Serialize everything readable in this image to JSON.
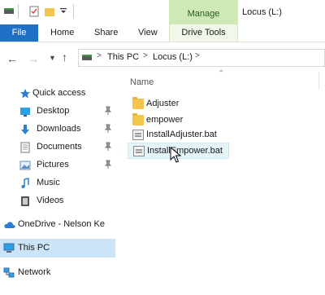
{
  "ribbon": {
    "manage_label": "Manage",
    "window_title": "Locus (L:)",
    "tabs": [
      "File",
      "Home",
      "Share",
      "View",
      "Drive Tools"
    ]
  },
  "address": {
    "crumbs": [
      "This PC",
      "Locus (L:)"
    ]
  },
  "nav": {
    "quick_access": "Quick access",
    "items": [
      "Desktop",
      "Downloads",
      "Documents",
      "Pictures",
      "Music",
      "Videos"
    ],
    "onedrive": "OneDrive - Nelson Ke",
    "this_pc": "This PC",
    "network": "Network"
  },
  "content": {
    "column_name": "Name",
    "files": [
      {
        "name": "Adjuster",
        "icon": "folder-icon"
      },
      {
        "name": "empower",
        "icon": "folder-icon"
      },
      {
        "name": "InstallAdjuster.bat",
        "icon": "batch-file-icon"
      },
      {
        "name": "InstallEmpower.bat",
        "icon": "batch-file-icon"
      }
    ]
  },
  "colors": {
    "accent": "#1e6fc6",
    "manage_tab": "#cfe9b6",
    "selected": "#cce4f7",
    "hover": "#e5f3fb"
  }
}
